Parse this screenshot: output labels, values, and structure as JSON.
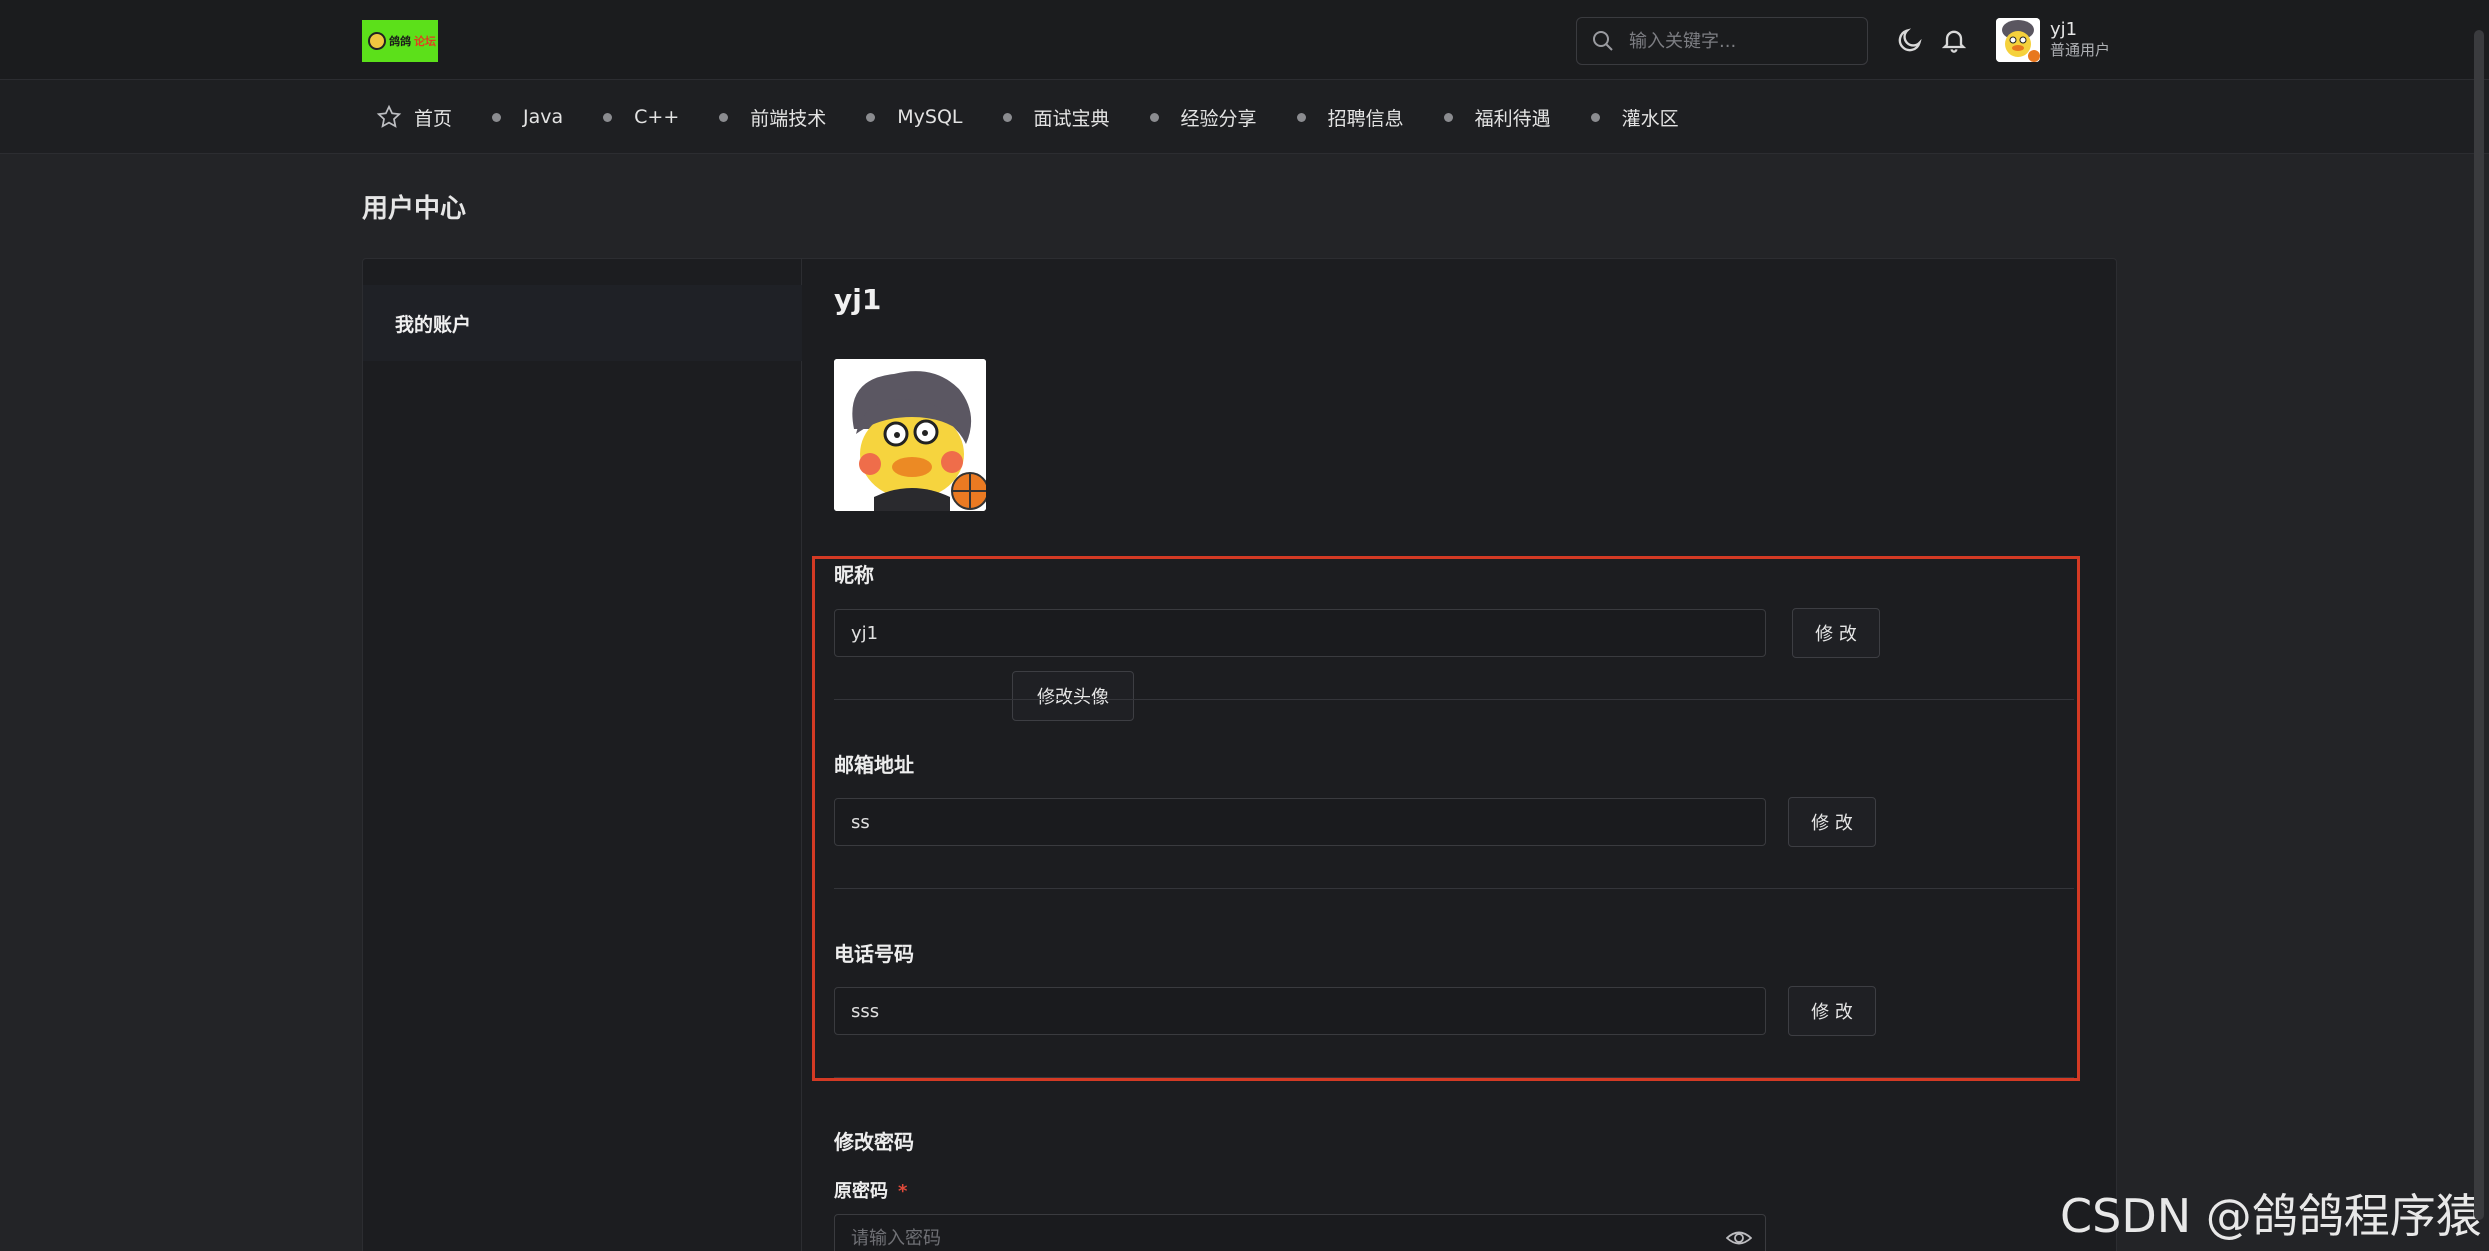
{
  "header": {
    "logo_text": "鸽鸽",
    "logo_accent": "论坛",
    "search_placeholder": "输入关键字...",
    "user_name": "yj1",
    "user_role": "普通用户"
  },
  "nav": {
    "items": [
      "首页",
      "Java",
      "C++",
      "前端技术",
      "MySQL",
      "面试宝典",
      "经验分享",
      "招聘信息",
      "福利待遇",
      "灌水区"
    ]
  },
  "page": {
    "title": "用户中心"
  },
  "sidebar": {
    "items": [
      {
        "label": "我的账户"
      }
    ]
  },
  "profile": {
    "user_name": "yj1",
    "change_avatar_label": "修改头像",
    "nickname": {
      "label": "昵称",
      "value": "yj1",
      "button": "修 改"
    },
    "email": {
      "label": "邮箱地址",
      "value": "ss",
      "button": "修 改"
    },
    "phone": {
      "label": "电话号码",
      "value": "sss",
      "button": "修 改"
    },
    "password": {
      "section_title": "修改密码",
      "old_label": "原密码",
      "required_mark": "*",
      "old_placeholder": "请输入密码"
    }
  },
  "watermark": "CSDN @鸽鸽程序猿",
  "colors": {
    "background": "#232427",
    "highlight_border": "#d43a24",
    "logo_green": "#5ce01a"
  }
}
